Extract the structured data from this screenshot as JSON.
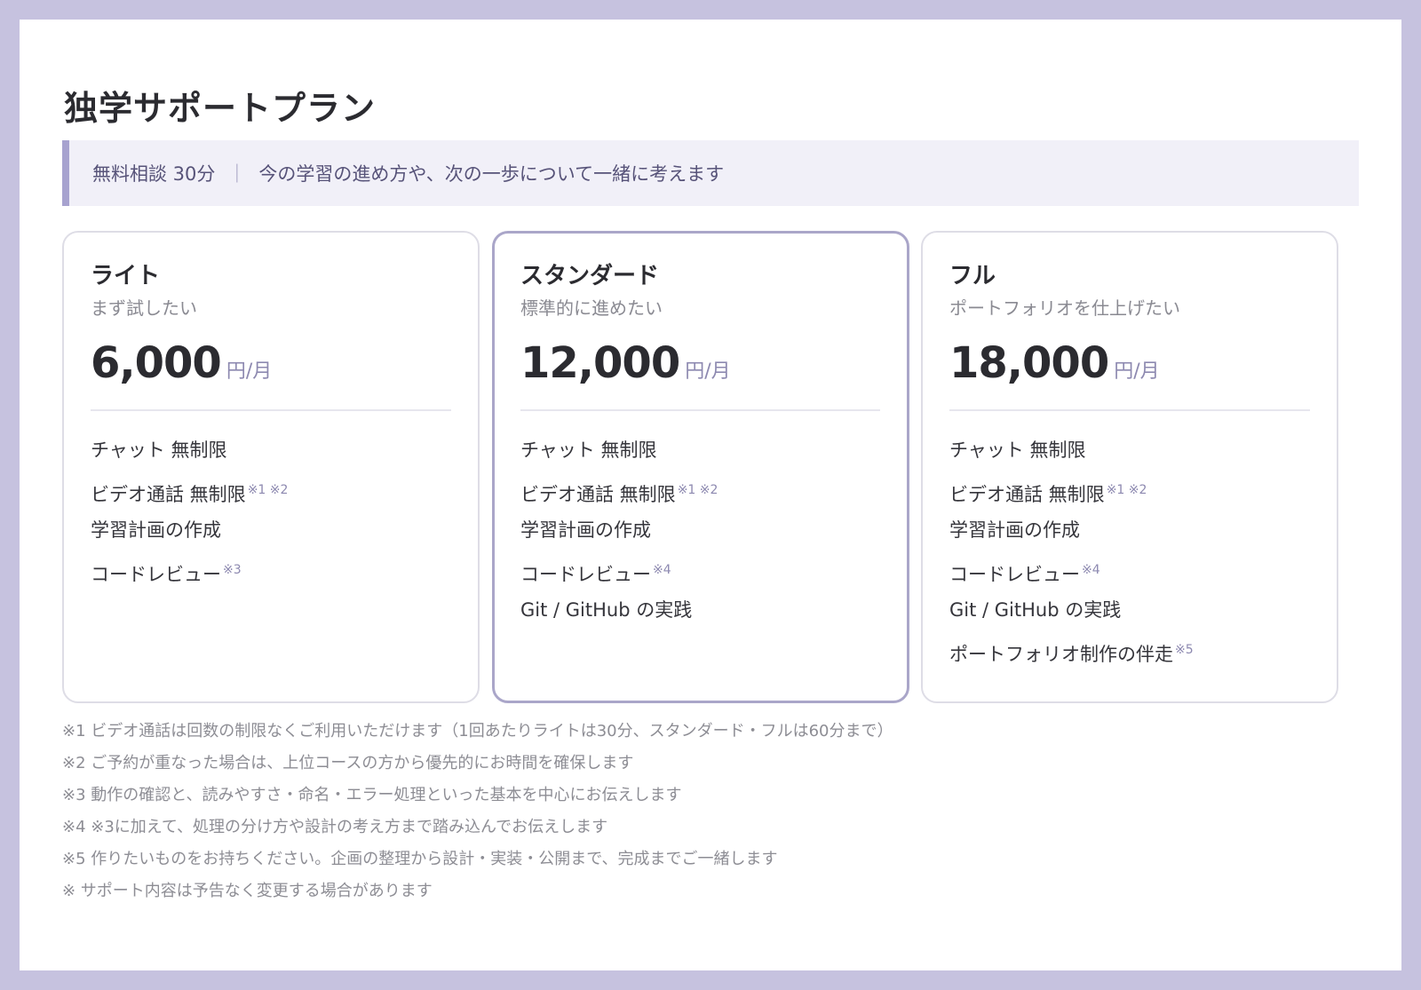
{
  "page": {
    "title": "独学サポートプラン",
    "notice": {
      "lead": "無料相談 30分",
      "separator": "｜",
      "text": "今の学習の進め方や、次の一歩について一緒に考えます"
    }
  },
  "plans": [
    {
      "name": "ライト",
      "subtitle": "まず試したい",
      "price": "6,000",
      "unit": "円/月",
      "features": [
        {
          "label": "チャット 無制限",
          "mark": ""
        },
        {
          "label": "ビデオ通話 無制限",
          "mark": "※1 ※2"
        },
        {
          "label": "学習計画の作成",
          "mark": ""
        },
        {
          "label": "コードレビュー",
          "mark": "※3"
        }
      ]
    },
    {
      "name": "スタンダード",
      "subtitle": "標準的に進めたい",
      "price": "12,000",
      "unit": "円/月",
      "features": [
        {
          "label": "チャット 無制限",
          "mark": ""
        },
        {
          "label": "ビデオ通話 無制限",
          "mark": "※1 ※2"
        },
        {
          "label": "学習計画の作成",
          "mark": ""
        },
        {
          "label": "コードレビュー",
          "mark": "※4"
        },
        {
          "label": "Git / GitHub の実践",
          "mark": ""
        }
      ]
    },
    {
      "name": "フル",
      "subtitle": "ポートフォリオを仕上げたい",
      "price": "18,000",
      "unit": "円/月",
      "features": [
        {
          "label": "チャット 無制限",
          "mark": ""
        },
        {
          "label": "ビデオ通話 無制限",
          "mark": "※1 ※2"
        },
        {
          "label": "学習計画の作成",
          "mark": ""
        },
        {
          "label": "コードレビュー",
          "mark": "※4"
        },
        {
          "label": "Git / GitHub の実践",
          "mark": ""
        },
        {
          "label": "ポートフォリオ制作の伴走",
          "mark": "※5"
        }
      ]
    }
  ],
  "notes": [
    "※1 ビデオ通話は回数の制限なくご利用いただけます（1回あたりライトは30分、スタンダード・フルは60分まで）",
    "※2 ご予約が重なった場合は、上位コースの方から優先的にお時間を確保します",
    "※3 動作の確認と、読みやすさ・命名・エラー処理といった基本を中心にお伝えします",
    "※4 ※3に加えて、処理の分け方や設計の考え方まで踏み込んでお伝えします",
    "※5 作りたいものをお持ちください。企画の整理から設計・実装・公開まで、完成までご一緒します",
    "※ サポート内容は予告なく変更する場合があります"
  ],
  "colors": {
    "frame": "#c6c2df",
    "accent": "#a7a2cf",
    "notice_bg": "#f1f0f8",
    "featured_border": "#aaa6c9"
  }
}
